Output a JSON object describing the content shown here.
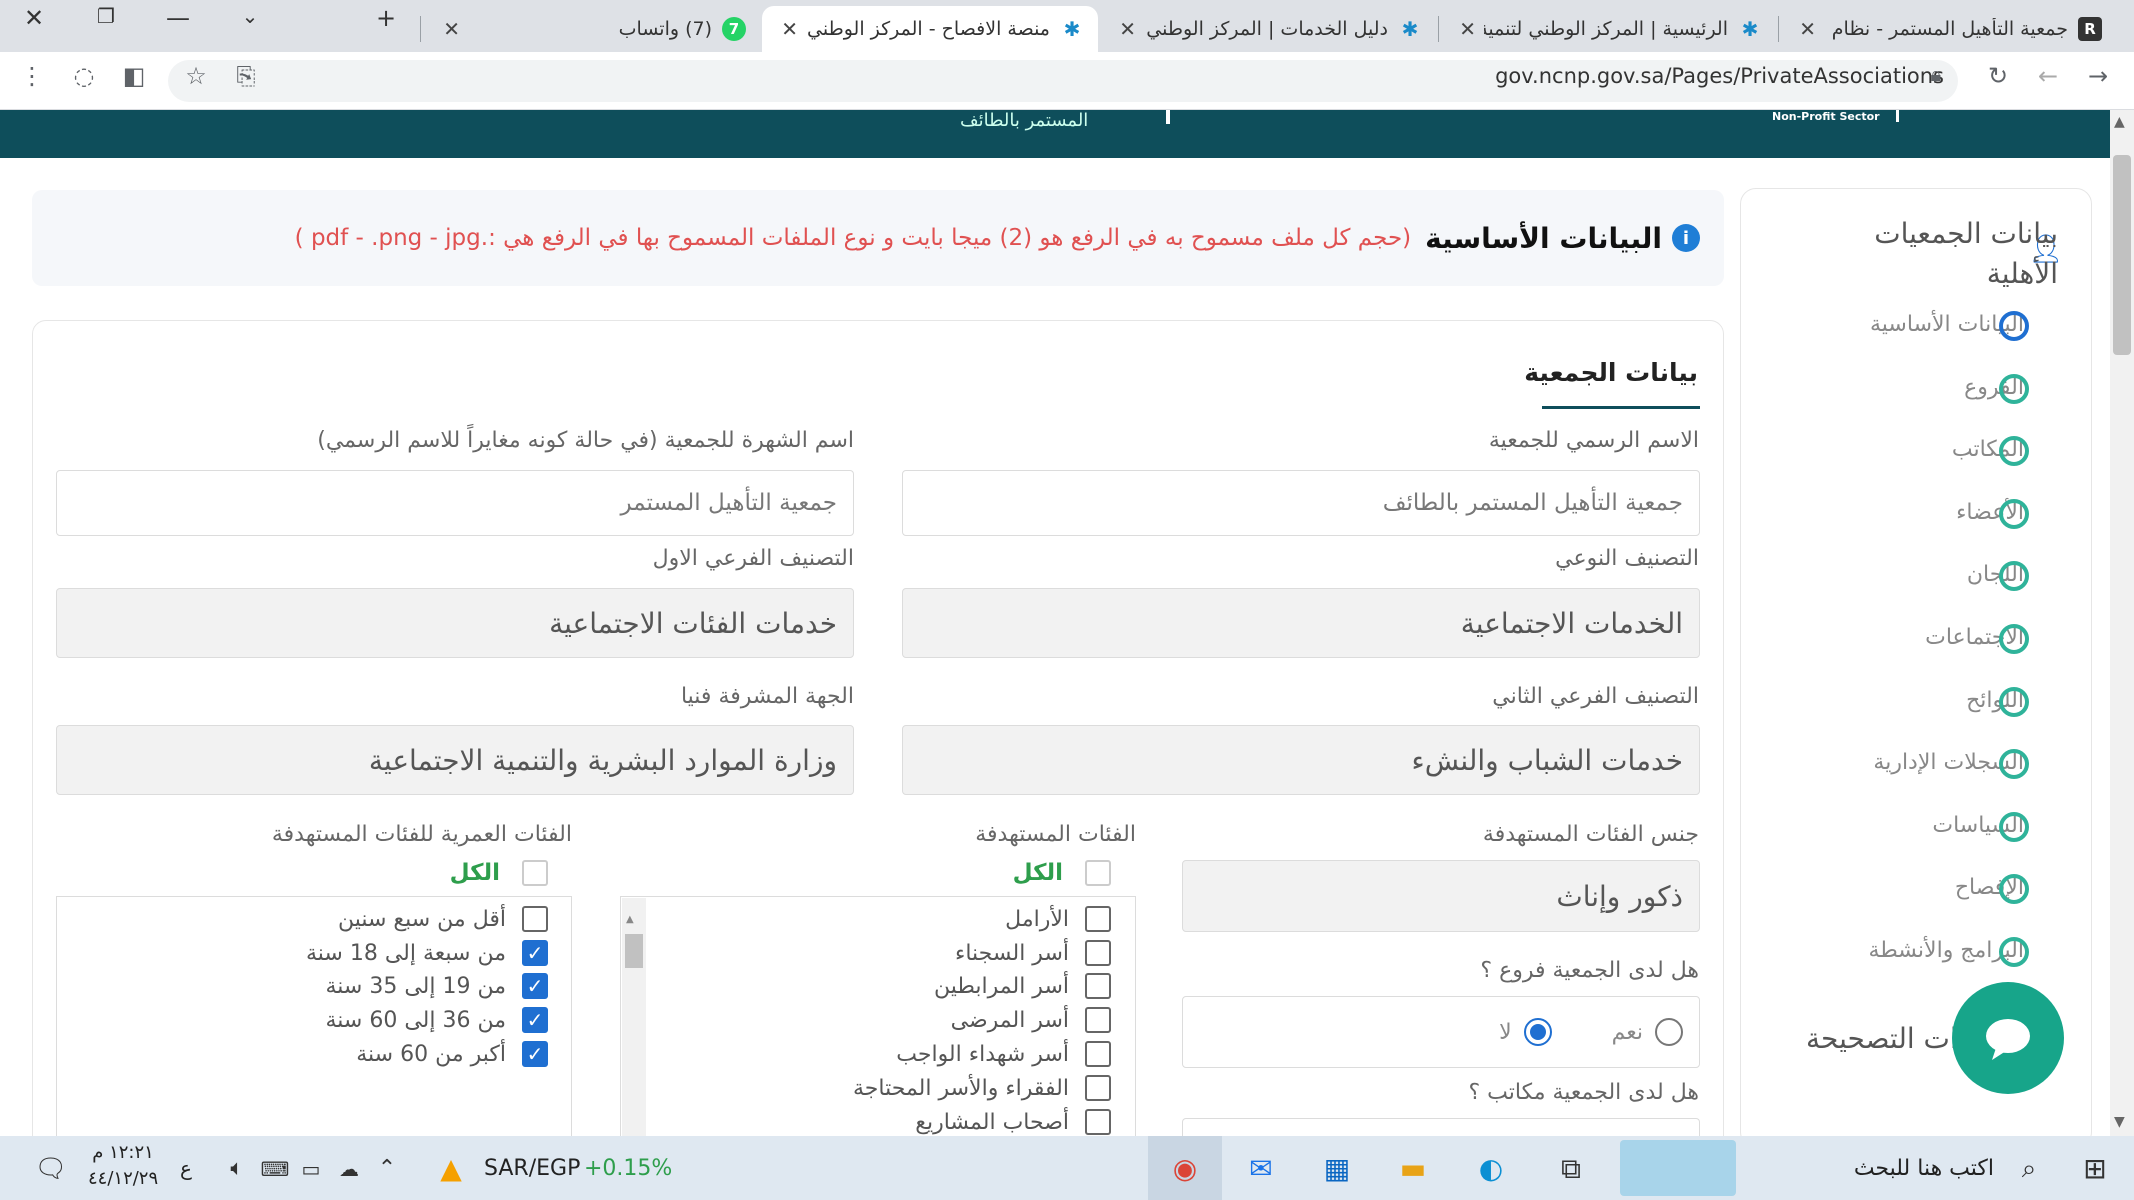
{
  "browser": {
    "tabs": [
      {
        "title": "جمعية التأهيل المستمر - نظام",
        "favicon": "R"
      },
      {
        "title": "الرئيسية | المركز الوطني لتنمية",
        "favicon": "✱"
      },
      {
        "title": "دليل الخدمات | المركز الوطني ل",
        "favicon": "✱"
      },
      {
        "title": "منصة الافصاح - المركز الوطني",
        "favicon": "✱",
        "active": true
      },
      {
        "title": "(7) واتساب",
        "favicon": "7"
      }
    ],
    "url": "gov.ncnp.gov.sa/Pages/PrivateAssociations"
  },
  "header": {
    "partial_text": "المستمر بالطائف",
    "logo_caption": "Non-Profit Sector"
  },
  "info": {
    "title": "البيانات الأساسية",
    "note": "(حجم كل ملف مسموح به في الرفع هو (2) ميجا بايت و نوع الملفات المسموح بها في الرفع هي :.pdf - .png - jpg )"
  },
  "form": {
    "section_title": "بيانات الجمعية",
    "official_name_label": "الاسم الرسمي للجمعية",
    "official_name_value": "جمعية التأهيل المستمر بالطائف",
    "popular_name_label": "اسم الشهرة للجمعية (في حالة كونه مغايراً للاسم الرسمي)",
    "popular_name_value": "جمعية التأهيل المستمر",
    "type_class_label": "التصنيف النوعي",
    "type_class_value": "الخدمات الاجتماعية",
    "sub_class1_label": "التصنيف الفرعي الاول",
    "sub_class1_value": "خدمات الفئات الاجتماعية",
    "sub_class2_label": "التصنيف الفرعي الثاني",
    "sub_class2_value": "خدمات الشباب والنشء",
    "supervisor_label": "الجهة المشرفة فنيا",
    "supervisor_value": "وزارة الموارد البشرية والتنمية الاجتماعية",
    "gender_label": "جنس الفئات المستهدفة",
    "gender_value": "ذكور وإناث",
    "target_groups_label": "الفئات المستهدفة",
    "age_groups_label": "الفئات العمرية للفئات المستهدفة",
    "all_label": "الكل",
    "target_groups": [
      {
        "label": "الأرامل",
        "checked": false
      },
      {
        "label": "أسر السجناء",
        "checked": false
      },
      {
        "label": "أسر المرابطين",
        "checked": false
      },
      {
        "label": "أسر المرضى",
        "checked": false
      },
      {
        "label": "أسر شهداء الواجب",
        "checked": false
      },
      {
        "label": "الفقراء والأسر المحتاجة",
        "checked": false
      },
      {
        "label": "أصحاب المشاريع",
        "checked": false
      }
    ],
    "age_groups": [
      {
        "label": "أقل من سبع سنين",
        "checked": false
      },
      {
        "label": "من سبعة إلى 18 سنة",
        "checked": true
      },
      {
        "label": "من 19 إلى 35 سنة",
        "checked": true
      },
      {
        "label": "من 36 إلى 60 سنة",
        "checked": true
      },
      {
        "label": "أكبر من 60 سنة",
        "checked": true
      }
    ],
    "branches_question": "هل لدى الجمعية فروع ؟",
    "offices_question": "هل لدى الجمعية مكاتب ؟",
    "yes_label": "نعم",
    "no_label": "لا",
    "branches_selected": "لا"
  },
  "sidebar": {
    "title": "بيانات الجمعيات الأهلية",
    "steps": [
      "البيانات الأساسية",
      "الفروع",
      "المكاتب",
      "الأعضاء",
      "اللجان",
      "الاجتماعات",
      "اللوائح",
      "السجلات الإدارية",
      "السياسات",
      "الإفصاح",
      "البرامج والأنشطة"
    ],
    "footer_partial": "ات التصحيحة"
  },
  "taskbar": {
    "search_placeholder": "اكتب هنا للبحث",
    "currency": "SAR/EGP",
    "currency_change": "+0.15%",
    "time": "١٢:٢١ م",
    "date": "٤٤/١٢/٢٩",
    "lang": "ع"
  },
  "colors": {
    "accent": "#1f6fd1",
    "brand": "#0e4e5b",
    "step_ring": "#2fb39a",
    "note": "#e05151"
  }
}
